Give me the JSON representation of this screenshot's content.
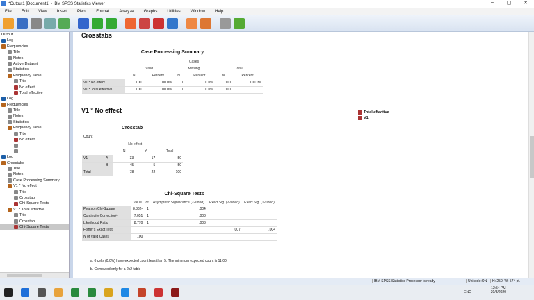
{
  "window": {
    "title": "*Output1 [Document1] - IBM SPSS Statistics Viewer",
    "minimize": "–",
    "maximize": "▢",
    "close": "✕"
  },
  "menu": [
    "File",
    "Edit",
    "View",
    "Insert",
    "Pivot",
    "Format",
    "Analyze",
    "Graphs",
    "Utilities",
    "Window",
    "Help"
  ],
  "toolbar": [
    {
      "name": "open",
      "color": "#f0a030"
    },
    {
      "name": "save",
      "color": "#3a6fc4"
    },
    {
      "name": "print",
      "color": "#888"
    },
    {
      "name": "print-preview",
      "color": "#7aa"
    },
    {
      "name": "export",
      "color": "#5a5"
    },
    {
      "name": "recall-dialog",
      "color": "#36c"
    },
    {
      "name": "undo",
      "color": "#3a3"
    },
    {
      "name": "redo",
      "color": "#3a3"
    },
    {
      "name": "goto-data",
      "color": "#e63"
    },
    {
      "name": "goto-variable",
      "color": "#c44"
    },
    {
      "name": "insert-cases",
      "color": "#c33"
    },
    {
      "name": "variables",
      "color": "#37c"
    },
    {
      "name": "edit",
      "color": "#e84"
    },
    {
      "name": "designate-window",
      "color": "#d73"
    },
    {
      "name": "disabled",
      "color": "#999"
    },
    {
      "name": "add",
      "color": "#5a3"
    }
  ],
  "outline": [
    {
      "label": "Output",
      "lvl": 0,
      "icon": ""
    },
    {
      "label": "Log",
      "lvl": 0,
      "icon": "lg"
    },
    {
      "label": "Frequencies",
      "lvl": 0,
      "icon": "bk"
    },
    {
      "label": "Title",
      "lvl": 1,
      "icon": ""
    },
    {
      "label": "Notes",
      "lvl": 1,
      "icon": ""
    },
    {
      "label": "Active Dataset",
      "lvl": 1,
      "icon": ""
    },
    {
      "label": "Statistics",
      "lvl": 1,
      "icon": ""
    },
    {
      "label": "Frequency Table",
      "lvl": 1,
      "icon": "bk"
    },
    {
      "label": "Title",
      "lvl": 2,
      "icon": ""
    },
    {
      "label": "No effect",
      "lvl": 2,
      "icon": "tb2"
    },
    {
      "label": "Total effective",
      "lvl": 2,
      "icon": "tb2"
    },
    {
      "label": "Log",
      "lvl": 0,
      "icon": "lg"
    },
    {
      "label": "Frequencies",
      "lvl": 0,
      "icon": "bk"
    },
    {
      "label": "Title",
      "lvl": 1,
      "icon": ""
    },
    {
      "label": "Notes",
      "lvl": 1,
      "icon": ""
    },
    {
      "label": "Statistics",
      "lvl": 1,
      "icon": ""
    },
    {
      "label": "Frequency Table",
      "lvl": 1,
      "icon": "bk"
    },
    {
      "label": "Title",
      "lvl": 2,
      "icon": ""
    },
    {
      "label": "No effect",
      "lvl": 2,
      "icon": "tb2"
    },
    {
      "label": "",
      "lvl": 2,
      "icon": ""
    },
    {
      "label": "",
      "lvl": 2,
      "icon": ""
    },
    {
      "label": "Log",
      "lvl": 0,
      "icon": "lg"
    },
    {
      "label": "Crosstabs",
      "lvl": 0,
      "icon": "bk"
    },
    {
      "label": "Title",
      "lvl": 1,
      "icon": ""
    },
    {
      "label": "Notes",
      "lvl": 1,
      "icon": ""
    },
    {
      "label": "Case Processing Summary",
      "lvl": 1,
      "icon": ""
    },
    {
      "label": "V1 * No effect",
      "lvl": 1,
      "icon": "bk"
    },
    {
      "label": "Title",
      "lvl": 2,
      "icon": ""
    },
    {
      "label": "Crosstab",
      "lvl": 2,
      "icon": ""
    },
    {
      "label": "Chi-Square Tests",
      "lvl": 2,
      "icon": "tb2"
    },
    {
      "label": "V1 * Total effective",
      "lvl": 1,
      "icon": "bk"
    },
    {
      "label": "Title",
      "lvl": 2,
      "icon": ""
    },
    {
      "label": "Crosstab",
      "lvl": 2,
      "icon": ""
    },
    {
      "label": "Chi-Square Tests",
      "lvl": 2,
      "icon": "tb2",
      "selected": true
    }
  ],
  "main": {
    "heading": "Crosstabs",
    "cps": {
      "title": "Case Processing Summary",
      "cases": "Cases",
      "groups": [
        "Valid",
        "Missing",
        "Total"
      ],
      "cols": [
        "N",
        "Percent",
        "N",
        "Percent",
        "N",
        "Percent"
      ],
      "rows": [
        {
          "label": "V1 * No effect",
          "vals": [
            "100",
            "100.0%",
            "0",
            "0.0%",
            "100",
            "100.0%"
          ]
        },
        {
          "label": "V1 * Total effective",
          "vals": [
            "100",
            "100.0%",
            "0",
            "0.0%",
            "100",
            ""
          ]
        }
      ]
    },
    "side_items": [
      "Total effective",
      "V1"
    ],
    "sub_heading": "V1 * No effect",
    "crosstab": {
      "title": "Crosstab",
      "count": "Count",
      "col_group": "No effect",
      "cols": [
        "N",
        "Y",
        "Total"
      ],
      "var": "V1",
      "rows": [
        {
          "cat": "A",
          "vals": [
            "33",
            "17",
            "50"
          ]
        },
        {
          "cat": "B",
          "vals": [
            "45",
            "5",
            "50"
          ]
        }
      ],
      "total": {
        "label": "Total",
        "vals": [
          "78",
          "22",
          "100"
        ]
      }
    },
    "chisq": {
      "title": "Chi-Square Tests",
      "cols": [
        "Value",
        "df",
        "Asymptotic Significance (2-sided)",
        "Exact Sig. (2-sided)",
        "Exact Sig. (1-sided)"
      ],
      "rows": [
        {
          "label": "Pearson Chi-Square",
          "vals": [
            "8.382ᵃ",
            "1",
            ".004",
            "",
            ""
          ]
        },
        {
          "label": "Continuity Correctionᵇ",
          "vals": [
            "7.051",
            "1",
            ".008",
            "",
            ""
          ]
        },
        {
          "label": "Likelihood Ratio",
          "vals": [
            "8.770",
            "1",
            ".003",
            "",
            ""
          ]
        },
        {
          "label": "Fisher's Exact Test",
          "vals": [
            "",
            "",
            "",
            ".007",
            ".004"
          ]
        },
        {
          "label": "N of Valid Cases",
          "vals": [
            "100",
            "",
            "",
            "",
            ""
          ]
        }
      ],
      "notes": [
        "a. 0 cells (0.0%) have expected count less than 5. The minimum expected count is 11.00.",
        "b. Computed only for a 2x2 table"
      ]
    }
  },
  "status": {
    "processor": "IBM SPSS Statistics Processor is ready",
    "unicode": "Unicode:ON",
    "size": "H: 250, W: 574 pt."
  },
  "taskbar": {
    "lang": "ENG",
    "time": "12:54 PM",
    "date": "30/8/2020",
    "apps": [
      "#1e6fd9",
      "#555",
      "#e8a33c",
      "#2a8a3e",
      "#2a8a3e",
      "#d9a41e",
      "#1e88e5",
      "#c4442a",
      "#c33",
      "#8b1a1a"
    ]
  }
}
